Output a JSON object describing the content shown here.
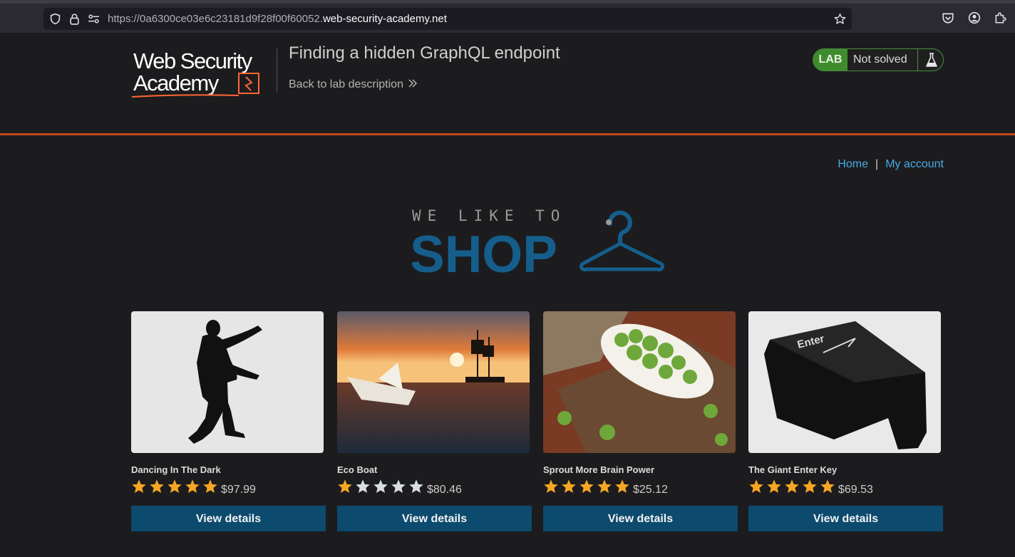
{
  "browser": {
    "url_prefix": "https://0a6300ce03e6c23181d9f28f00f60052.",
    "url_domain": "web-security-academy.net"
  },
  "header": {
    "logo_line1": "Web Security",
    "logo_line2": "Academy",
    "lab_title": "Finding a hidden GraphQL endpoint",
    "back_link": "Back to lab description",
    "status_badge": "LAB",
    "status_text": "Not solved"
  },
  "nav": {
    "home": "Home",
    "separator": "|",
    "account": "My account"
  },
  "shop_logo": {
    "tagline": "WE LIKE TO",
    "word": "SHOP"
  },
  "colors": {
    "accent_orange": "#c4491f",
    "button_blue": "#0c4a6e",
    "link_blue": "#4aa9e6",
    "lab_green": "#3f8c2f",
    "star_filled": "#f5a623",
    "star_empty": "#d6dde3"
  },
  "products": [
    {
      "name": "Dancing In The Dark",
      "rating": 5,
      "price": "$97.99",
      "button": "View details"
    },
    {
      "name": "Eco Boat",
      "rating": 1,
      "price": "$80.46",
      "button": "View details"
    },
    {
      "name": "Sprout More Brain Power",
      "rating": 5,
      "price": "$25.12",
      "button": "View details"
    },
    {
      "name": "The Giant Enter Key",
      "rating": 5,
      "price": "$69.53",
      "button": "View details"
    }
  ]
}
